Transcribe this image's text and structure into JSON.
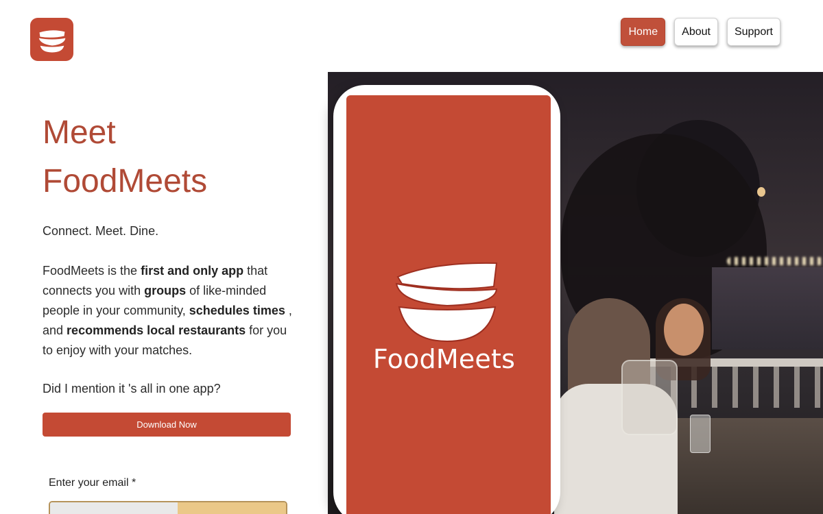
{
  "brand": {
    "logo_icon": "bowls-icon",
    "accent_color": "#c44a34",
    "phone_brand_name": "FoodMeets"
  },
  "nav": {
    "items": [
      {
        "label": "Home",
        "active": true
      },
      {
        "label": "About",
        "active": false
      },
      {
        "label": "Support",
        "active": false
      }
    ]
  },
  "hero": {
    "title_line1": "Meet",
    "title_line2": "FoodMeets",
    "tagline": "Connect. Meet. Dine.",
    "desc_1": "FoodMeets is the ",
    "desc_b1": "first and only app",
    "desc_2": " that connects you with ",
    "desc_b2": "groups",
    "desc_3": " of like-minded people in your community, ",
    "desc_b3": "schedules times",
    "desc_4": " , and ",
    "desc_b4": "recommends local restaurants",
    "desc_5": " for you to enjoy with your matches.",
    "question": "Did I mention it 's all in one app?",
    "download_label": "Download Now"
  },
  "signup": {
    "email_label": "Enter your email *",
    "email_value": "",
    "email_placeholder": ""
  }
}
